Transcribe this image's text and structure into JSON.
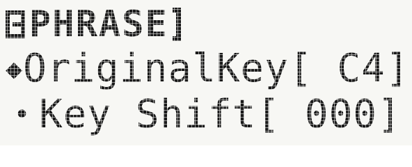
{
  "screen": {
    "title": "PHRASE",
    "rows": [
      {
        "marker": "◆",
        "label": "OriginalKey",
        "value": "[ C4]"
      },
      {
        "marker": "•",
        "label": "Key Shift",
        "value": "[ 000]"
      }
    ]
  }
}
